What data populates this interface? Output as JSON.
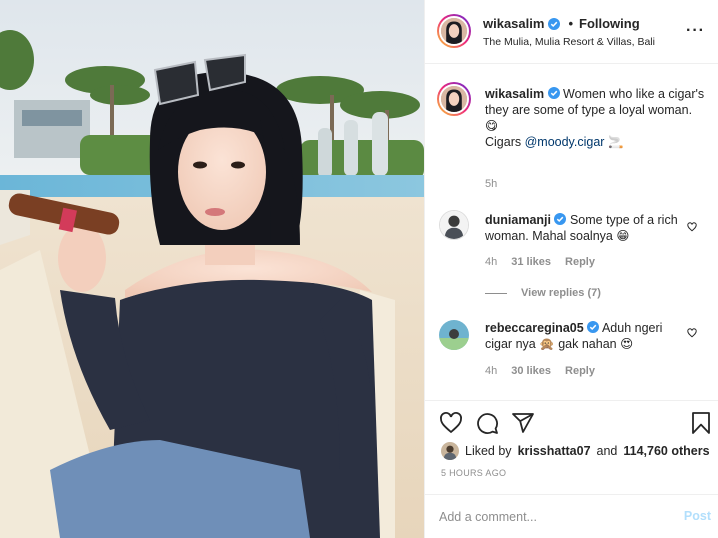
{
  "photo": {
    "alt": ""
  },
  "post_header": {
    "username": "wikasalim",
    "separator": "•",
    "follow_status": "Following",
    "location": "The Mulia, Mulia Resort & Villas, Bali",
    "more_icon": "more-horizontal-icon"
  },
  "caption": {
    "username": "wikasalim",
    "text": "Women who like a cigar's they are some of type a loyal woman.",
    "emoji": "😋",
    "mention_prefix": "Cigars ",
    "mention": "@moody.cigar",
    "mention_emoji": "🚬",
    "time": "5h"
  },
  "comments": [
    {
      "username": "duniamanji",
      "text": "Some type of a rich woman. Mahal soalnya 😁",
      "time": "4h",
      "likes": "31 likes",
      "reply": "Reply",
      "view_replies": "View replies (7)"
    },
    {
      "username": "rebeccaregina05",
      "text": "Aduh ngeri cigar nya 🙊 gak nahan 😍",
      "time": "4h",
      "likes": "30 likes",
      "reply": "Reply"
    }
  ],
  "actions": {
    "like_icon": "heart-icon",
    "comment_icon": "comment-icon",
    "share_icon": "send-icon",
    "save_icon": "bookmark-icon"
  },
  "likes": {
    "prefix": "Liked by",
    "user": "krisshatta07",
    "and": "and",
    "others": "114,760 others"
  },
  "timestamp": "5 HOURS AGO",
  "add_comment": {
    "placeholder": "Add a comment...",
    "post_label": "Post"
  },
  "colors": {
    "verified": "#3897f0",
    "link": "#00376b",
    "muted": "#8e8e8e",
    "post_disabled": "#b2dffc"
  }
}
